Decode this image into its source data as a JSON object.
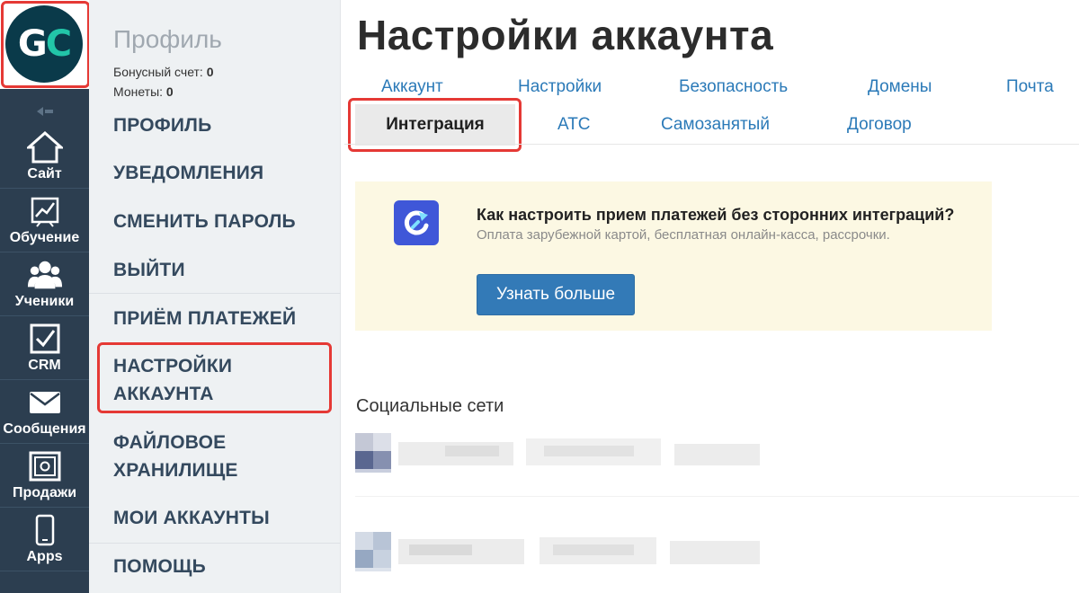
{
  "rail": {
    "logo_letters": [
      "G",
      "C"
    ],
    "items": [
      {
        "label": "Сайт",
        "icon": "home-icon"
      },
      {
        "label": "Обучение",
        "icon": "chart-icon"
      },
      {
        "label": "Ученики",
        "icon": "users-icon"
      },
      {
        "label": "CRM",
        "icon": "checkbox-icon"
      },
      {
        "label": "Сообщения",
        "icon": "envelope-icon"
      },
      {
        "label": "Продажи",
        "icon": "safe-icon"
      },
      {
        "label": "Apps",
        "icon": "phone-icon"
      }
    ],
    "collapse_icon": "collapse-arrow-icon"
  },
  "sidebar": {
    "title": "Профиль",
    "bonus_label": "Бонусный счет:",
    "bonus_value": "0",
    "coins_label": "Монеты:",
    "coins_value": "0",
    "items": [
      {
        "label": "ПРОФИЛЬ"
      },
      {
        "label": "УВЕДОМЛЕНИЯ"
      },
      {
        "label": "СМЕНИТЬ ПАРОЛЬ"
      },
      {
        "label": "ВЫЙТИ"
      },
      {
        "label": "ПРИЁМ ПЛАТЕЖЕЙ"
      },
      {
        "label": "НАСТРОЙКИ",
        "label2": "АККАУНТА"
      },
      {
        "label": "ФАЙЛОВОЕ",
        "label2": "ХРАНИЛИЩЕ"
      },
      {
        "label": "МОИ АККАУНТЫ"
      },
      {
        "label": "ПОМОЩЬ"
      }
    ]
  },
  "main": {
    "title": "Настройки аккаунта",
    "tabs": [
      {
        "label": "Аккаунт"
      },
      {
        "label": "Настройки"
      },
      {
        "label": "Безопасность"
      },
      {
        "label": "Домены"
      },
      {
        "label": "Почта"
      },
      {
        "label": "Интеграция",
        "active": true
      },
      {
        "label": "АТС"
      },
      {
        "label": "Самозанятый"
      },
      {
        "label": "Договор"
      }
    ],
    "promo": {
      "icon": "refresh-logo-icon",
      "heading": "Как настроить прием платежей без сторонних интеграций?",
      "subtext": "Оплата зарубежной картой, бесплатная онлайн-касса, рассрочки.",
      "button": "Узнать больше"
    },
    "social_title": "Социальные сети"
  },
  "colors": {
    "rail_bg": "#2c3e50",
    "sidebar_bg": "#eef1f3",
    "link": "#2b7ab8",
    "button": "#337ab7",
    "highlight": "#e53935",
    "promo_bg": "#fcf8e3"
  }
}
